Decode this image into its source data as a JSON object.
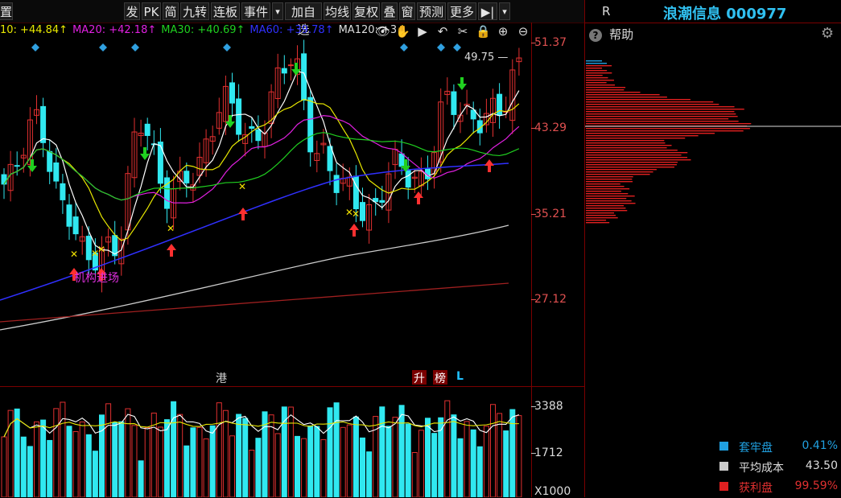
{
  "toolbar": {
    "left_cut_label": "置",
    "buttons": [
      "发",
      "PK",
      "简",
      "九转",
      "连板",
      "事件",
      "▾",
      "加自选",
      "均线",
      "复权",
      "叠",
      "窗",
      "预测",
      "更多",
      "▶|",
      "▾"
    ]
  },
  "ma_legend": [
    {
      "label": "10: +44.84↑",
      "color": "#e8e800"
    },
    {
      "label": "MA20: +42.18↑",
      "color": "#e020e0"
    },
    {
      "label": "MA30: +40.69↑",
      "color": "#20d020"
    },
    {
      "label": "MA60: +39.78↑",
      "color": "#3030ff"
    },
    {
      "label": "MA120: +3",
      "color": "#dddddd"
    }
  ],
  "tool_icons": [
    "eye-icon",
    "hand-icon",
    "play-icon",
    "undo-icon",
    "scissors-icon",
    "lock-icon",
    "zoom-in-icon",
    "zoom-out-icon"
  ],
  "price_axis": [
    "51.37",
    "43.29",
    "35.21",
    "27.12"
  ],
  "volume_axis": [
    "3388",
    "1712",
    "X1000"
  ],
  "price_marker": "49.75",
  "annotation": "机构进场",
  "event_tags": [
    {
      "text": "港",
      "color": "#e0d000",
      "bg": ""
    },
    {
      "text": "升",
      "color": "#ffffff",
      "bg": "#7a0000"
    },
    {
      "text": "榜",
      "color": "#ffffff",
      "bg": "#7a0000"
    },
    {
      "text": "L",
      "color": "#20c0ff",
      "bg": ""
    }
  ],
  "stock_header": {
    "r_label": "R",
    "title": "浪潮信息 000977"
  },
  "help": {
    "label": "帮助"
  },
  "chip_legend": [
    {
      "label": "套牢盘",
      "value": "0.41%",
      "color": "#20a0e0",
      "value_color": "#20a0e0"
    },
    {
      "label": "平均成本",
      "value": "43.50",
      "color": "#cccccc",
      "value_color": "#dddddd"
    },
    {
      "label": "获利盘",
      "value": "99.59%",
      "color": "#e02020",
      "value_color": "#e03030"
    }
  ],
  "colors": {
    "up": "#e23030",
    "down": "#30e8f0",
    "grid": "#7a0000"
  }
}
